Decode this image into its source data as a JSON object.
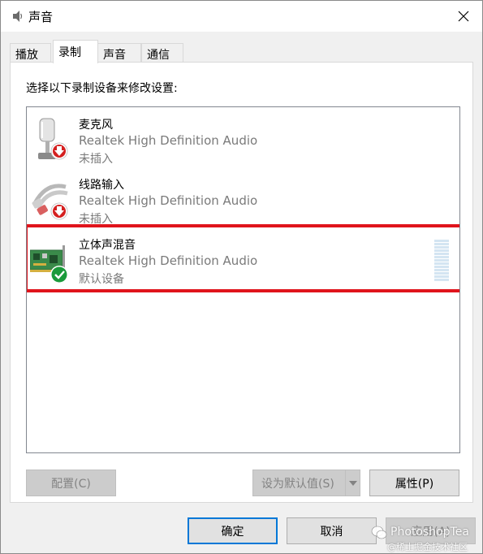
{
  "window": {
    "title": "声音",
    "icon": "speaker-icon",
    "close_icon": "close-icon"
  },
  "tabs": [
    {
      "label": "播放",
      "active": false
    },
    {
      "label": "录制",
      "active": true
    },
    {
      "label": "声音",
      "active": false
    },
    {
      "label": "通信",
      "active": false
    }
  ],
  "panel": {
    "instruction": "选择以下录制设备来修改设置:"
  },
  "devices": [
    {
      "name": "麦克风",
      "driver": "Realtek High Definition Audio",
      "status": "未插入",
      "icon": "microphone-icon",
      "badge": "unplugged-red-arrow-icon"
    },
    {
      "name": "线路输入",
      "driver": "Realtek High Definition Audio",
      "status": "未插入",
      "icon": "line-in-cable-icon",
      "badge": "unplugged-red-arrow-icon"
    },
    {
      "name": "立体声混音",
      "driver": "Realtek High Definition Audio",
      "status": "默认设备",
      "icon": "sound-card-icon",
      "badge": "default-green-check-icon",
      "highlighted": true
    }
  ],
  "panel_buttons": {
    "configure": "配置(C)",
    "set_default": "设为默认值(S)",
    "properties": "属性(P)"
  },
  "dialog_buttons": {
    "ok": "确定",
    "cancel": "取消",
    "apply": "应用(A)"
  },
  "watermark": {
    "main": "PhotoshopTea",
    "sub": "@稀土掘金技术社区"
  },
  "colors": {
    "highlight_border": "#e0141c",
    "primary_border": "#0078d7",
    "disabled_text": "#838383",
    "secondary_text": "#7a7a7a"
  }
}
